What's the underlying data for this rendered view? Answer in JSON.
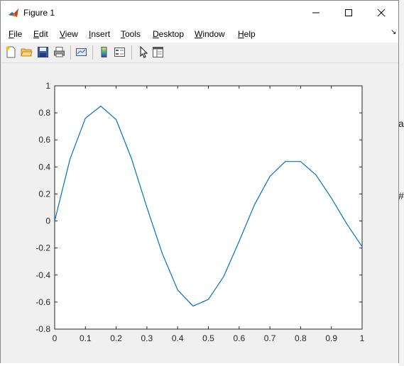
{
  "window": {
    "title": "Figure 1",
    "minimize_label": "—",
    "maximize_label": "☐",
    "close_label": "✕"
  },
  "menubar": {
    "items": [
      {
        "label": "File",
        "hotkey": "F"
      },
      {
        "label": "Edit",
        "hotkey": "E"
      },
      {
        "label": "View",
        "hotkey": "V"
      },
      {
        "label": "Insert",
        "hotkey": "I"
      },
      {
        "label": "Tools",
        "hotkey": "T"
      },
      {
        "label": "Desktop",
        "hotkey": "D"
      },
      {
        "label": "Window",
        "hotkey": "W"
      },
      {
        "label": "Help",
        "hotkey": "H"
      }
    ],
    "dock_arrow": "↘"
  },
  "toolbar": {
    "icons": [
      "new-figure-icon",
      "open-file-icon",
      "save-icon",
      "print-icon",
      "link-plot-icon",
      "colorbar-icon",
      "legend-icon",
      "edit-plot-arrow-icon",
      "property-inspector-icon"
    ]
  },
  "chart_data": {
    "type": "line",
    "title": "",
    "xlabel": "",
    "ylabel": "",
    "xlim": [
      0,
      1
    ],
    "ylim": [
      -0.8,
      1
    ],
    "xticks": [
      "0",
      "0.1",
      "0.2",
      "0.3",
      "0.4",
      "0.5",
      "0.6",
      "0.7",
      "0.8",
      "0.9",
      "1"
    ],
    "yticks": [
      "1",
      "0.8",
      "0.6",
      "0.4",
      "0.2",
      "0",
      "-0.2",
      "-0.4",
      "-0.6",
      "-0.8"
    ],
    "grid": false,
    "series": [
      {
        "color": "#0072bd",
        "x": [
          0,
          0.05,
          0.1,
          0.15,
          0.2,
          0.25,
          0.3,
          0.35,
          0.4,
          0.45,
          0.5,
          0.55,
          0.6,
          0.65,
          0.7,
          0.75,
          0.8,
          0.85,
          0.9,
          0.95,
          1
        ],
        "y": [
          0,
          0.46,
          0.76,
          0.85,
          0.75,
          0.46,
          0.1,
          -0.24,
          -0.51,
          -0.63,
          -0.58,
          -0.41,
          -0.15,
          0.12,
          0.33,
          0.44,
          0.44,
          0.34,
          0.17,
          -0.02,
          -0.19
        ]
      }
    ]
  }
}
